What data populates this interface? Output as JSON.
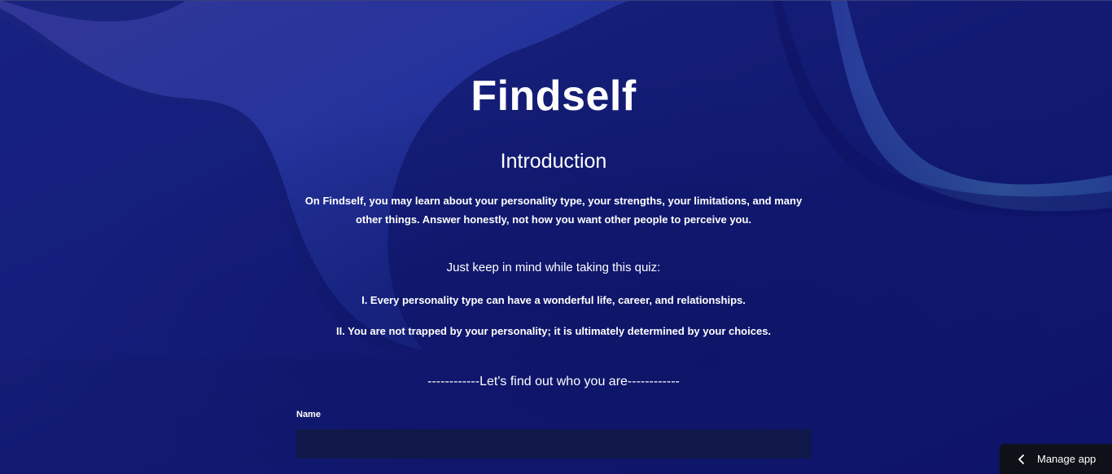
{
  "app": {
    "title": "Findself"
  },
  "intro": {
    "heading": "Introduction",
    "paragraph": "On Findself, you may learn about your personality type, your strengths, your limitations, and many other things. Answer honestly, not how you want other people to perceive you.",
    "keep_in_mind": "Just keep in mind while taking this quiz:",
    "points": [
      "I. Every personality type can have a wonderful life, career, and relationships.",
      "II. You are not trapped by your personality; it is ultimately determined by your choices."
    ],
    "divider": "------------Let's find out who you are------------"
  },
  "form": {
    "name_label": "Name",
    "name_value": "",
    "name_placeholder": ""
  },
  "manage_app": {
    "label": "Manage app",
    "icon": "chevron-left-icon"
  },
  "colors": {
    "background": "#10166b",
    "input_bg": "#0f1848",
    "manage_bg": "#0e1117"
  }
}
